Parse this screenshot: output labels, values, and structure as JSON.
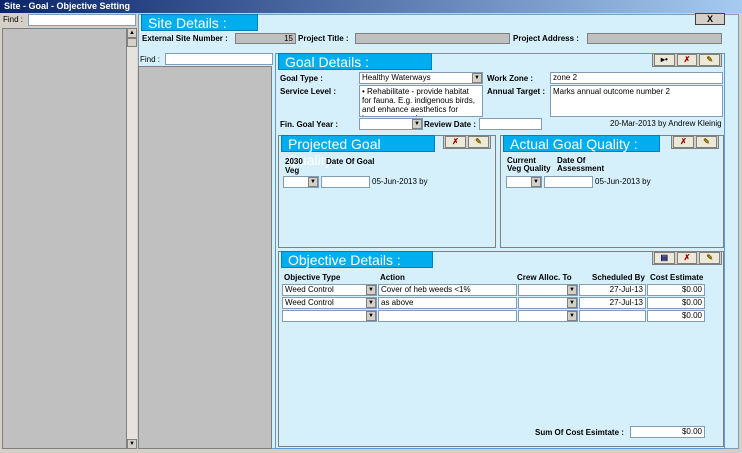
{
  "window": {
    "title": "Site - Goal - Objective Setting",
    "close": "X"
  },
  "left": {
    "find_label": "Find :",
    "find_value": ""
  },
  "mid": {
    "find_label": "Find :",
    "find_value": ""
  },
  "site": {
    "header": "Site Details :",
    "ext_label": "External Site Number :",
    "ext_value": "15",
    "proj_label": "Project Title :",
    "proj_value": "",
    "addr_label": "Project Address :",
    "addr_value": ""
  },
  "goal": {
    "header": "Goal Details :",
    "type_label": "Goal Type :",
    "type_value": "Healthy Waterways",
    "zone_label": "Work Zone :",
    "zone_value": "zone 2",
    "service_label": "Service Level :",
    "service_value": "•  Rehabilitate - provide habitat for fauna.  E.g. indigenous birds, and enhance aesthetics for human use and",
    "annual_label": "Annual Target :",
    "annual_value": "Marks annual outcome number 2",
    "fin_label": "Fin. Goal Year :",
    "fin_value": "",
    "review_label": "Review Date :",
    "review_value": "",
    "audit": "20-Mar-2013 by Andrew Kleinig"
  },
  "projected": {
    "header": "Projected Goal Quality :",
    "col1": "2030\nVeg",
    "col2": "Date Of Goal",
    "by": "05-Jun-2013 by"
  },
  "actual": {
    "header": "Actual Goal Quality :",
    "col1": "Current\nVeg Quality",
    "col2": "Date Of\nAssessment",
    "by": "05-Jun-2013 by"
  },
  "objective": {
    "header": "Objective Details :",
    "cols": [
      "Objective Type",
      "Action",
      "Crew Alloc. To",
      "Scheduled By",
      "Cost Estimate"
    ],
    "rows": [
      {
        "type": "Weed Control",
        "action": "Cover of heb weeds <1%",
        "crew": "",
        "sched": "27-Jul-13",
        "cost": "$0.00"
      },
      {
        "type": "Weed Control",
        "action": "as above",
        "crew": "",
        "sched": "27-Jul-13",
        "cost": "$0.00"
      },
      {
        "type": "",
        "action": "",
        "crew": "",
        "sched": "",
        "cost": "$0.00"
      }
    ],
    "sum_label": "Sum Of Cost Esimtate :",
    "sum_value": "$0.00"
  },
  "colors": {
    "accent": "#00aeef",
    "panel": "#d6f0fb",
    "title_start": "#0a246a"
  }
}
